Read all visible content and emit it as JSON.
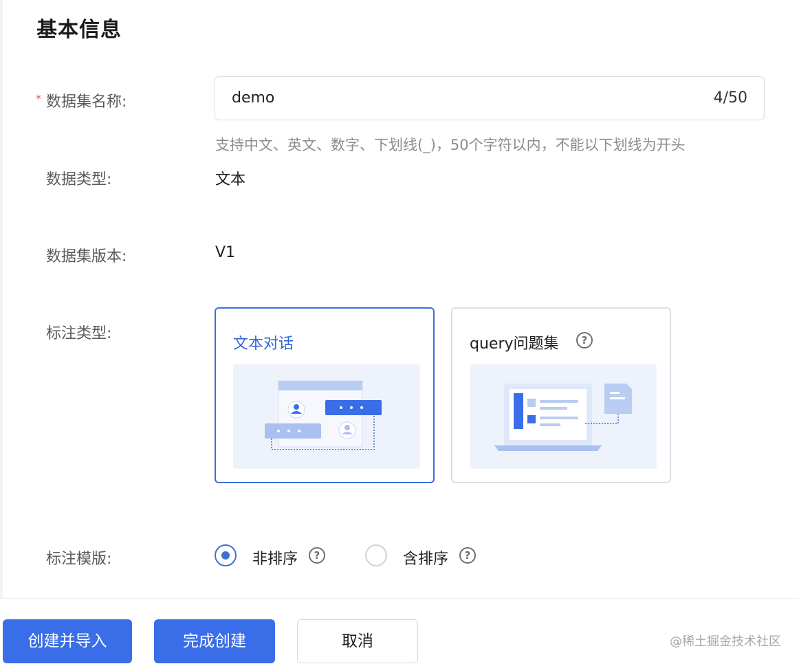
{
  "section": {
    "title": "基本信息"
  },
  "form": {
    "name": {
      "label": "数据集名称:",
      "required_mark": "*",
      "value": "demo",
      "counter": "4/50",
      "hint": "支持中文、英文、数字、下划线(_)，50个字符以内，不能以下划线为开头"
    },
    "data_type": {
      "label": "数据类型:",
      "value": "文本"
    },
    "version": {
      "label": "数据集版本:",
      "value": "V1"
    },
    "annotation_type": {
      "label": "标注类型:",
      "options": [
        {
          "label": "文本对话",
          "selected": true
        },
        {
          "label": "query问题集",
          "selected": false
        }
      ]
    },
    "template": {
      "label": "标注模版:",
      "options": [
        {
          "label": "非排序",
          "checked": true
        },
        {
          "label": "含排序",
          "checked": false
        }
      ]
    }
  },
  "footer": {
    "create_import": "创建并导入",
    "finish": "完成创建",
    "cancel": "取消",
    "watermark": "@稀土掘金技术社区"
  },
  "colors": {
    "accent": "#3a6ee8",
    "required": "#e5484d"
  },
  "icons": {
    "help": "question-circle-icon"
  }
}
